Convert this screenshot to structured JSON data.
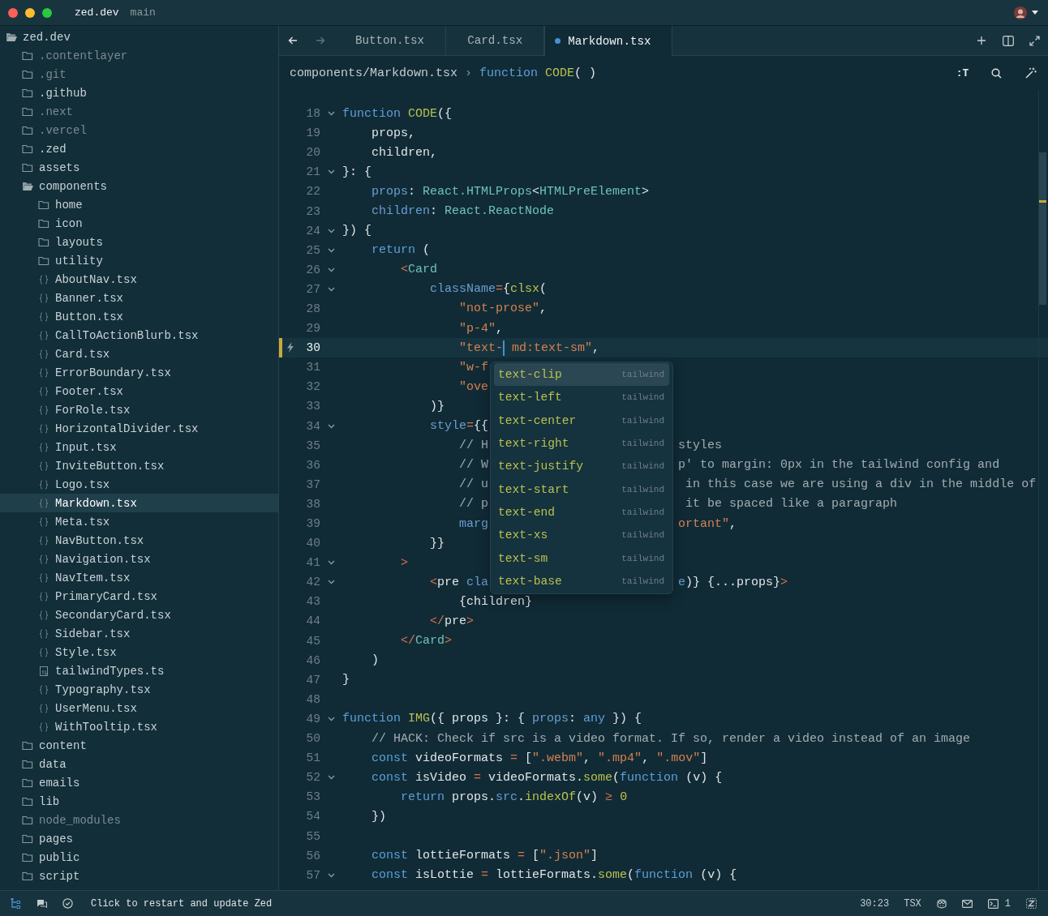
{
  "titlebar": {
    "project": "zed.dev",
    "branch": "main"
  },
  "sidebar": {
    "tree": [
      {
        "name": "zed.dev",
        "kind": "folder",
        "expanded": true,
        "dimmed": false,
        "selected": false,
        "children": [
          {
            "name": ".contentlayer",
            "kind": "folder",
            "expanded": false,
            "dimmed": true,
            "selected": false
          },
          {
            "name": ".git",
            "kind": "folder",
            "expanded": false,
            "dimmed": true,
            "selected": false
          },
          {
            "name": ".github",
            "kind": "folder",
            "expanded": false,
            "dimmed": false,
            "selected": false
          },
          {
            "name": ".next",
            "kind": "folder",
            "expanded": false,
            "dimmed": true,
            "selected": false
          },
          {
            "name": ".vercel",
            "kind": "folder",
            "expanded": false,
            "dimmed": true,
            "selected": false
          },
          {
            "name": ".zed",
            "kind": "folder",
            "expanded": false,
            "dimmed": false,
            "selected": false
          },
          {
            "name": "assets",
            "kind": "folder",
            "expanded": false,
            "dimmed": false,
            "selected": false
          },
          {
            "name": "components",
            "kind": "folder",
            "expanded": true,
            "dimmed": false,
            "selected": false,
            "children": [
              {
                "name": "home",
                "kind": "folder",
                "expanded": false,
                "dimmed": false,
                "selected": false
              },
              {
                "name": "icon",
                "kind": "folder",
                "expanded": false,
                "dimmed": false,
                "selected": false
              },
              {
                "name": "layouts",
                "kind": "folder",
                "expanded": false,
                "dimmed": false,
                "selected": false
              },
              {
                "name": "utility",
                "kind": "folder",
                "expanded": false,
                "dimmed": false,
                "selected": false
              },
              {
                "name": "AboutNav.tsx",
                "kind": "file",
                "dimmed": false,
                "selected": false
              },
              {
                "name": "Banner.tsx",
                "kind": "file",
                "dimmed": false,
                "selected": false
              },
              {
                "name": "Button.tsx",
                "kind": "file",
                "dimmed": false,
                "selected": false
              },
              {
                "name": "CallToActionBlurb.tsx",
                "kind": "file",
                "dimmed": false,
                "selected": false
              },
              {
                "name": "Card.tsx",
                "kind": "file",
                "dimmed": false,
                "selected": false
              },
              {
                "name": "ErrorBoundary.tsx",
                "kind": "file",
                "dimmed": false,
                "selected": false
              },
              {
                "name": "Footer.tsx",
                "kind": "file",
                "dimmed": false,
                "selected": false
              },
              {
                "name": "ForRole.tsx",
                "kind": "file",
                "dimmed": false,
                "selected": false
              },
              {
                "name": "HorizontalDivider.tsx",
                "kind": "file",
                "dimmed": false,
                "selected": false
              },
              {
                "name": "Input.tsx",
                "kind": "file",
                "dimmed": false,
                "selected": false
              },
              {
                "name": "InviteButton.tsx",
                "kind": "file",
                "dimmed": false,
                "selected": false
              },
              {
                "name": "Logo.tsx",
                "kind": "file",
                "dimmed": false,
                "selected": false
              },
              {
                "name": "Markdown.tsx",
                "kind": "file",
                "dimmed": false,
                "selected": true
              },
              {
                "name": "Meta.tsx",
                "kind": "file",
                "dimmed": false,
                "selected": false
              },
              {
                "name": "NavButton.tsx",
                "kind": "file",
                "dimmed": false,
                "selected": false
              },
              {
                "name": "Navigation.tsx",
                "kind": "file",
                "dimmed": false,
                "selected": false
              },
              {
                "name": "NavItem.tsx",
                "kind": "file",
                "dimmed": false,
                "selected": false
              },
              {
                "name": "PrimaryCard.tsx",
                "kind": "file",
                "dimmed": false,
                "selected": false
              },
              {
                "name": "SecondaryCard.tsx",
                "kind": "file",
                "dimmed": false,
                "selected": false
              },
              {
                "name": "Sidebar.tsx",
                "kind": "file",
                "dimmed": false,
                "selected": false
              },
              {
                "name": "Style.tsx",
                "kind": "file",
                "dimmed": false,
                "selected": false
              },
              {
                "name": "tailwindTypes.ts",
                "kind": "ts-file",
                "dimmed": false,
                "selected": false
              },
              {
                "name": "Typography.tsx",
                "kind": "file",
                "dimmed": false,
                "selected": false
              },
              {
                "name": "UserMenu.tsx",
                "kind": "file",
                "dimmed": false,
                "selected": false
              },
              {
                "name": "WithTooltip.tsx",
                "kind": "file",
                "dimmed": false,
                "selected": false
              }
            ]
          },
          {
            "name": "content",
            "kind": "folder",
            "expanded": false,
            "dimmed": false,
            "selected": false
          },
          {
            "name": "data",
            "kind": "folder",
            "expanded": false,
            "dimmed": false,
            "selected": false
          },
          {
            "name": "emails",
            "kind": "folder",
            "expanded": false,
            "dimmed": false,
            "selected": false
          },
          {
            "name": "lib",
            "kind": "folder",
            "expanded": false,
            "dimmed": false,
            "selected": false
          },
          {
            "name": "node_modules",
            "kind": "folder",
            "expanded": false,
            "dimmed": true,
            "selected": false
          },
          {
            "name": "pages",
            "kind": "folder",
            "expanded": false,
            "dimmed": false,
            "selected": false
          },
          {
            "name": "public",
            "kind": "folder",
            "expanded": false,
            "dimmed": false,
            "selected": false
          },
          {
            "name": "script",
            "kind": "folder",
            "expanded": false,
            "dimmed": false,
            "selected": false
          }
        ]
      }
    ]
  },
  "history": [
    {
      "kind": "back",
      "disabled": false
    },
    {
      "kind": "forward",
      "disabled": true
    }
  ],
  "tabs": [
    {
      "label": "Button.tsx",
      "selected": false,
      "modified": false
    },
    {
      "label": "Card.tsx",
      "selected": false,
      "modified": false
    },
    {
      "label": "Markdown.tsx",
      "selected": true,
      "modified": true
    }
  ],
  "breadcrumb": {
    "path": "components/Markdown.tsx",
    "separator": "›",
    "symbol": [
      {
        "kind": "kw",
        "text": "function "
      },
      {
        "kind": "fn",
        "text": "CODE"
      },
      {
        "kind": "plain",
        "text": "( )"
      }
    ]
  },
  "breadcrumb_actions": [
    {
      "kind": "text",
      "label": ":T"
    },
    {
      "kind": "search"
    },
    {
      "kind": "assist"
    }
  ],
  "lines": [
    {
      "number": "18",
      "fold": true,
      "active": false,
      "code": [
        {
          "kind": "kw",
          "text": "function "
        },
        {
          "kind": "fn",
          "text": "CODE"
        },
        {
          "kind": "plain",
          "text": "({"
        }
      ]
    },
    {
      "number": "19",
      "fold": false,
      "active": false,
      "code": [
        {
          "kind": "plain",
          "text": "    props,"
        }
      ]
    },
    {
      "number": "20",
      "fold": false,
      "active": false,
      "code": [
        {
          "kind": "plain",
          "text": "    children,"
        }
      ]
    },
    {
      "number": "21",
      "fold": true,
      "active": false,
      "code": [
        {
          "kind": "plain",
          "text": "}: {"
        }
      ]
    },
    {
      "number": "22",
      "fold": false,
      "active": false,
      "code": [
        {
          "kind": "prop",
          "text": "    props"
        },
        {
          "kind": "plain",
          "text": ": "
        },
        {
          "kind": "type",
          "text": "React.HTMLProps"
        },
        {
          "kind": "plain",
          "text": "<"
        },
        {
          "kind": "type",
          "text": "HTMLPreElement"
        },
        {
          "kind": "plain",
          "text": ">"
        }
      ]
    },
    {
      "number": "23",
      "fold": false,
      "active": false,
      "code": [
        {
          "kind": "prop",
          "text": "    children"
        },
        {
          "kind": "plain",
          "text": ": "
        },
        {
          "kind": "type",
          "text": "React.ReactNode"
        }
      ]
    },
    {
      "number": "24",
      "fold": true,
      "active": false,
      "code": [
        {
          "kind": "plain",
          "text": "}) {"
        }
      ]
    },
    {
      "number": "25",
      "fold": true,
      "active": false,
      "code": [
        {
          "kind": "kw",
          "text": "    return"
        },
        {
          "kind": "plain",
          "text": " ("
        }
      ]
    },
    {
      "number": "26",
      "fold": true,
      "active": false,
      "code": [
        {
          "kind": "op",
          "text": "        <"
        },
        {
          "kind": "type",
          "text": "Card"
        }
      ]
    },
    {
      "number": "27",
      "fold": true,
      "active": false,
      "code": [
        {
          "kind": "prop",
          "text": "            className"
        },
        {
          "kind": "op",
          "text": "="
        },
        {
          "kind": "plain",
          "text": "{"
        },
        {
          "kind": "fn",
          "text": "clsx"
        },
        {
          "kind": "plain",
          "text": "("
        }
      ]
    },
    {
      "number": "28",
      "fold": false,
      "active": false,
      "code": [
        {
          "kind": "str",
          "text": "                \"not-prose\""
        },
        {
          "kind": "plain",
          "text": ","
        }
      ]
    },
    {
      "number": "29",
      "fold": false,
      "active": false,
      "code": [
        {
          "kind": "str",
          "text": "                \"p-4\""
        },
        {
          "kind": "plain",
          "text": ","
        }
      ]
    },
    {
      "number": "30",
      "fold": false,
      "active": true,
      "code": [
        {
          "kind": "str",
          "text": "                \"text-"
        },
        {
          "kind": "cursor"
        },
        {
          "kind": "str",
          "text": " md:text-sm\""
        },
        {
          "kind": "plain",
          "text": ","
        }
      ]
    },
    {
      "number": "31",
      "fold": false,
      "active": false,
      "code": [
        {
          "kind": "str",
          "text": "                \"w-f"
        }
      ]
    },
    {
      "number": "32",
      "fold": false,
      "active": false,
      "code": [
        {
          "kind": "str",
          "text": "                \"ove"
        }
      ]
    },
    {
      "number": "33",
      "fold": false,
      "active": false,
      "code": [
        {
          "kind": "plain",
          "text": "            )}"
        }
      ]
    },
    {
      "number": "34",
      "fold": true,
      "active": false,
      "code": [
        {
          "kind": "prop",
          "text": "            style"
        },
        {
          "kind": "op",
          "text": "="
        },
        {
          "kind": "plain",
          "text": "{{"
        }
      ]
    },
    {
      "number": "35",
      "fold": false,
      "active": false,
      "code": [
        {
          "kind": "comment",
          "text": "                // H"
        }
      ],
      "after": [
        {
          "kind": "comment",
          "text": "styles"
        }
      ]
    },
    {
      "number": "36",
      "fold": false,
      "active": false,
      "code": [
        {
          "kind": "comment",
          "text": "                // W"
        }
      ],
      "after": [
        {
          "kind": "comment",
          "text": "p' to margin: 0px in the tailwind config and"
        }
      ]
    },
    {
      "number": "37",
      "fold": false,
      "active": false,
      "code": [
        {
          "kind": "comment",
          "text": "                // u"
        }
      ],
      "after": [
        {
          "kind": "comment",
          "text": " in this case we are using a div in the middle of"
        }
      ]
    },
    {
      "number": "38",
      "fold": false,
      "active": false,
      "code": [
        {
          "kind": "comment",
          "text": "                // p"
        }
      ],
      "after": [
        {
          "kind": "comment",
          "text": " it be spaced like a paragraph"
        }
      ]
    },
    {
      "number": "39",
      "fold": false,
      "active": false,
      "code": [
        {
          "kind": "prop",
          "text": "                marg"
        }
      ],
      "after": [
        {
          "kind": "str",
          "text": "ortant\""
        },
        {
          "kind": "plain",
          "text": ","
        }
      ]
    },
    {
      "number": "40",
      "fold": false,
      "active": false,
      "code": [
        {
          "kind": "plain",
          "text": "            }}"
        }
      ]
    },
    {
      "number": "41",
      "fold": true,
      "active": false,
      "code": [
        {
          "kind": "op",
          "text": "        >"
        }
      ]
    },
    {
      "number": "42",
      "fold": true,
      "active": false,
      "code": [
        {
          "kind": "op",
          "text": "            <"
        },
        {
          "kind": "plain",
          "text": "pre"
        },
        {
          "kind": "prop",
          "text": " cla"
        }
      ],
      "after": [
        {
          "kind": "prop",
          "text": "e"
        },
        {
          "kind": "plain",
          "text": ")} {...props}"
        },
        {
          "kind": "op",
          "text": ">"
        }
      ]
    },
    {
      "number": "43",
      "fold": false,
      "active": false,
      "code": [
        {
          "kind": "plain",
          "text": "                {children}"
        }
      ]
    },
    {
      "number": "44",
      "fold": false,
      "active": false,
      "code": [
        {
          "kind": "op",
          "text": "            </"
        },
        {
          "kind": "plain",
          "text": "pre"
        },
        {
          "kind": "op",
          "text": ">"
        }
      ]
    },
    {
      "number": "45",
      "fold": false,
      "active": false,
      "code": [
        {
          "kind": "op",
          "text": "        </"
        },
        {
          "kind": "type",
          "text": "Card"
        },
        {
          "kind": "op",
          "text": ">"
        }
      ]
    },
    {
      "number": "46",
      "fold": false,
      "active": false,
      "code": [
        {
          "kind": "plain",
          "text": "    )"
        }
      ]
    },
    {
      "number": "47",
      "fold": false,
      "active": false,
      "code": [
        {
          "kind": "plain",
          "text": "}"
        }
      ]
    },
    {
      "number": "48",
      "fold": false,
      "active": false
    },
    {
      "number": "49",
      "fold": true,
      "active": false,
      "code": [
        {
          "kind": "kw",
          "text": "function "
        },
        {
          "kind": "fn",
          "text": "IMG"
        },
        {
          "kind": "plain",
          "text": "({ props }: { "
        },
        {
          "kind": "prop",
          "text": "props"
        },
        {
          "kind": "plain",
          "text": ": "
        },
        {
          "kind": "kw",
          "text": "any"
        },
        {
          "kind": "plain",
          "text": " }) {"
        }
      ]
    },
    {
      "number": "50",
      "fold": false,
      "active": false,
      "code": [
        {
          "kind": "comment",
          "text": "    // HACK: Check if src is a video format. If so, render a video instead of an image"
        }
      ]
    },
    {
      "number": "51",
      "fold": false,
      "active": false,
      "code": [
        {
          "kind": "kw",
          "text": "    const "
        },
        {
          "kind": "plain",
          "text": "videoFormats "
        },
        {
          "kind": "op",
          "text": "= "
        },
        {
          "kind": "plain",
          "text": "["
        },
        {
          "kind": "str",
          "text": "\".webm\""
        },
        {
          "kind": "plain",
          "text": ", "
        },
        {
          "kind": "str",
          "text": "\".mp4\""
        },
        {
          "kind": "plain",
          "text": ", "
        },
        {
          "kind": "str",
          "text": "\".mov\""
        },
        {
          "kind": "plain",
          "text": "]"
        }
      ]
    },
    {
      "number": "52",
      "fold": true,
      "active": false,
      "code": [
        {
          "kind": "kw",
          "text": "    const "
        },
        {
          "kind": "plain",
          "text": "isVideo "
        },
        {
          "kind": "op",
          "text": "= "
        },
        {
          "kind": "plain",
          "text": "videoFormats."
        },
        {
          "kind": "fn",
          "text": "some"
        },
        {
          "kind": "plain",
          "text": "("
        },
        {
          "kind": "kw",
          "text": "function"
        },
        {
          "kind": "plain",
          "text": " (v) {"
        }
      ]
    },
    {
      "number": "53",
      "fold": false,
      "active": false,
      "code": [
        {
          "kind": "kw",
          "text": "        return "
        },
        {
          "kind": "plain",
          "text": "props."
        },
        {
          "kind": "prop",
          "text": "src"
        },
        {
          "kind": "plain",
          "text": "."
        },
        {
          "kind": "fn",
          "text": "indexOf"
        },
        {
          "kind": "plain",
          "text": "(v) "
        },
        {
          "kind": "op",
          "text": "≥"
        },
        {
          "kind": "num",
          "text": " 0"
        }
      ]
    },
    {
      "number": "54",
      "fold": false,
      "active": false,
      "code": [
        {
          "kind": "plain",
          "text": "    })"
        }
      ]
    },
    {
      "number": "55",
      "fold": false,
      "active": false
    },
    {
      "number": "56",
      "fold": false,
      "active": false,
      "code": [
        {
          "kind": "kw",
          "text": "    const "
        },
        {
          "kind": "plain",
          "text": "lottieFormats "
        },
        {
          "kind": "op",
          "text": "= "
        },
        {
          "kind": "plain",
          "text": "["
        },
        {
          "kind": "str",
          "text": "\".json\""
        },
        {
          "kind": "plain",
          "text": "]"
        }
      ]
    },
    {
      "number": "57",
      "fold": true,
      "active": false,
      "code": [
        {
          "kind": "kw",
          "text": "    const "
        },
        {
          "kind": "plain",
          "text": "isLottie "
        },
        {
          "kind": "op",
          "text": "= "
        },
        {
          "kind": "plain",
          "text": "lottieFormats."
        },
        {
          "kind": "fn",
          "text": "some"
        },
        {
          "kind": "plain",
          "text": "("
        },
        {
          "kind": "kw",
          "text": "function"
        },
        {
          "kind": "plain",
          "text": " (v) {"
        }
      ]
    }
  ],
  "completions": [
    {
      "label": "text-clip",
      "source": "tailwind",
      "selected": true
    },
    {
      "label": "text-left",
      "source": "tailwind",
      "selected": false
    },
    {
      "label": "text-center",
      "source": "tailwind",
      "selected": false
    },
    {
      "label": "text-right",
      "source": "tailwind",
      "selected": false
    },
    {
      "label": "text-justify",
      "source": "tailwind",
      "selected": false
    },
    {
      "label": "text-start",
      "source": "tailwind",
      "selected": false
    },
    {
      "label": "text-end",
      "source": "tailwind",
      "selected": false
    },
    {
      "label": "text-xs",
      "source": "tailwind",
      "selected": false
    },
    {
      "label": "text-sm",
      "source": "tailwind",
      "selected": false
    },
    {
      "label": "text-base",
      "source": "tailwind",
      "selected": false
    }
  ],
  "status_bar": {
    "left": [
      {
        "kind": "project",
        "active": true
      },
      {
        "kind": "chat",
        "active": false
      },
      {
        "kind": "check",
        "active": false
      }
    ],
    "message": "Click to restart and update Zed",
    "cursor": "30:23",
    "language": "TSX",
    "right": [
      {
        "kind": "copilot"
      },
      {
        "kind": "mail"
      },
      {
        "kind": "terminal",
        "label": "1"
      },
      {
        "kind": "zed"
      }
    ]
  }
}
